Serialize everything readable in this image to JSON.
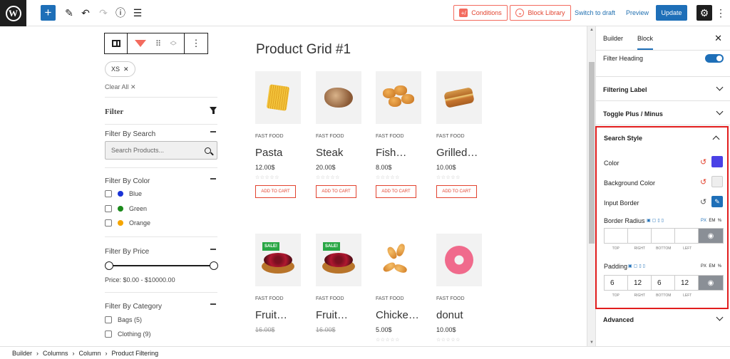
{
  "topbar": {
    "conditions_label": "Conditions",
    "block_library_label": "Block Library",
    "switch_to_draft": "Switch to draft",
    "preview": "Preview",
    "update": "Update"
  },
  "filter": {
    "active_chip": "XS",
    "clear_all": "Clear All",
    "title": "Filter",
    "by_search": "Filter By Search",
    "search_placeholder": "Search Products...",
    "by_color": "Filter By Color",
    "colors": [
      {
        "label": "Blue",
        "color": "#1a33d6"
      },
      {
        "label": "Green",
        "color": "#1b8a1b"
      },
      {
        "label": "Orange",
        "color": "#f5a500"
      }
    ],
    "by_price": "Filter By Price",
    "price_text": "Price: $0.00 - $10000.00",
    "by_category": "Filter By Category",
    "categories": [
      "Bags (5)",
      "Clothing (9)"
    ]
  },
  "grid": {
    "title": "Product Grid #1",
    "products": [
      {
        "category": "FAST FOOD",
        "name": "Pasta",
        "price": "12.00$",
        "cart": "ADD TO CART"
      },
      {
        "category": "FAST FOOD",
        "name": "Steak",
        "price": "20.00$",
        "cart": "ADD TO CART"
      },
      {
        "category": "FAST FOOD",
        "name": "Fish…",
        "price": "8.00$",
        "cart": "ADD TO CART"
      },
      {
        "category": "FAST FOOD",
        "name": "Grilled…",
        "price": "10.00$",
        "cart": "ADD TO CART"
      },
      {
        "category": "FAST FOOD",
        "name": "Fruit…",
        "old_price": "16.00$",
        "sale": "SALE!"
      },
      {
        "category": "FAST FOOD",
        "name": "Fruit…",
        "old_price": "16.00$",
        "sale": "SALE!"
      },
      {
        "category": "FAST FOOD",
        "name": "Chicke…",
        "price": "5.00$"
      },
      {
        "category": "FAST FOOD",
        "name": "donut",
        "price": "10.00$"
      }
    ]
  },
  "sidebar": {
    "tabs": [
      "Builder",
      "Block"
    ],
    "filter_heading": "Filter Heading",
    "filtering_label": "Filtering Label",
    "toggle_plus_minus": "Toggle Plus / Minus",
    "search_style": "Search Style",
    "color_label": "Color",
    "color_value": "#4a41e6",
    "bg_color_label": "Background Color",
    "bg_color_value": "#eeeeee",
    "input_border_label": "Input Border",
    "border_radius_label": "Border Radius",
    "padding_label": "Padding",
    "units": [
      "PX",
      "EM",
      "%"
    ],
    "dim_labels": [
      "TOP",
      "RIGHT",
      "BOTTOM",
      "LEFT"
    ],
    "padding_values": [
      "6",
      "12",
      "6",
      "12"
    ],
    "advanced": "Advanced"
  },
  "breadcrumb": [
    "Builder",
    "Columns",
    "Column",
    "Product Filtering"
  ],
  "colors": {
    "accent": "#1e6fb8",
    "brand_red": "#e2432f",
    "highlight": "#e11d1d"
  }
}
